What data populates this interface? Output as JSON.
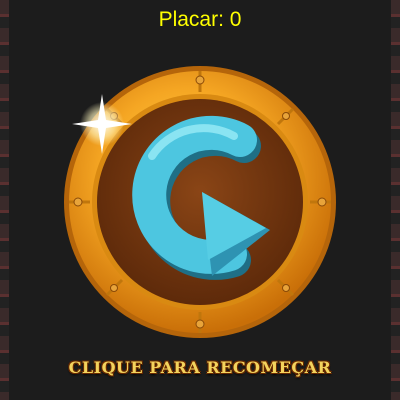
{
  "hud": {
    "score_text": "Placar: 0"
  },
  "restart": {
    "label": "CLIQUE PARA RECOMEÇAR",
    "icon": "circular-arrow-icon"
  },
  "colors": {
    "background": "#1c1c1c",
    "score": "#ffff00",
    "label": "#f3d35d",
    "coin_gold": "#f5a623",
    "coin_center": "#7a3b12",
    "arrow": "#4dc6e0"
  }
}
